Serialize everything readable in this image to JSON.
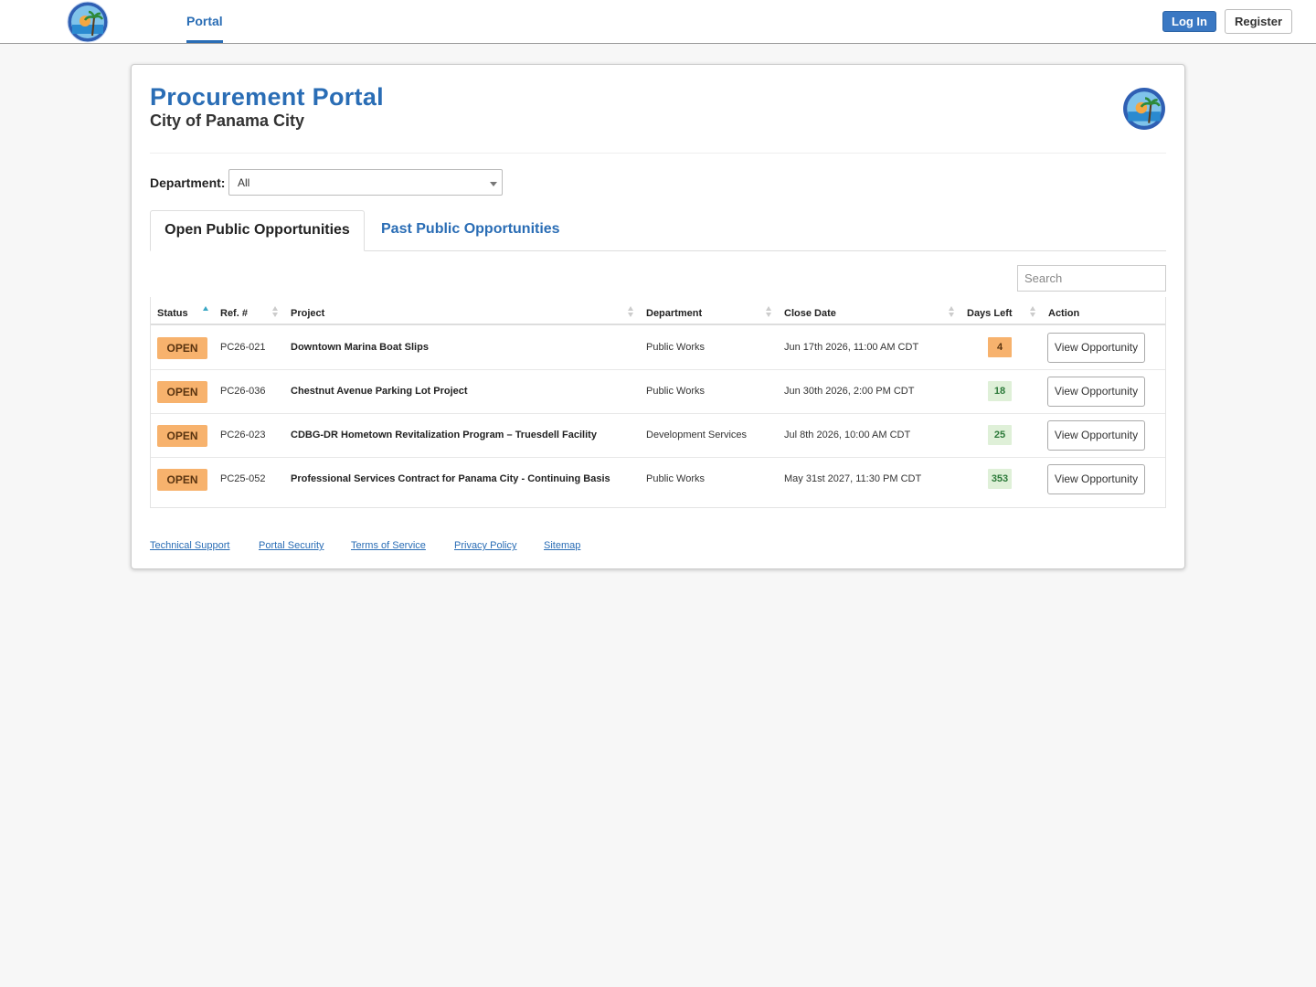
{
  "nav": {
    "portal_label": "Portal",
    "login_label": "Log In",
    "register_label": "Register"
  },
  "header": {
    "title": "Procurement Portal",
    "subtitle": "City of Panama City"
  },
  "filter": {
    "department_label": "Department:",
    "department_value": "All"
  },
  "tabs": [
    {
      "label": "Open Public Opportunities",
      "active": true
    },
    {
      "label": "Past Public Opportunities",
      "active": false
    }
  ],
  "search": {
    "placeholder": "Search"
  },
  "table": {
    "columns": [
      "Status",
      "Ref. #",
      "Project",
      "Department",
      "Close Date",
      "Days Left",
      "Action"
    ],
    "rows": [
      {
        "status": "OPEN",
        "ref": "PC26-021",
        "project": "Downtown Marina Boat Slips",
        "department": "Public Works",
        "close_date": "Jun 17th 2026, 11:00 AM CDT",
        "days_left": "4",
        "action": "View Opportunity"
      },
      {
        "status": "OPEN",
        "ref": "PC26-036",
        "project": "Chestnut Avenue Parking Lot Project",
        "department": "Public Works",
        "close_date": "Jun 30th 2026, 2:00 PM CDT",
        "days_left": "18",
        "action": "View Opportunity"
      },
      {
        "status": "OPEN",
        "ref": "PC26-023",
        "project": "CDBG-DR Hometown Revitalization Program – Truesdell Facility",
        "department": "Development Services",
        "close_date": "Jul 8th 2026, 10:00 AM CDT",
        "days_left": "25",
        "action": "View Opportunity"
      },
      {
        "status": "OPEN",
        "ref": "PC25-052",
        "project": "Professional Services Contract for Panama City - Continuing Basis",
        "department": "Public Works",
        "close_date": "May 31st 2027, 11:30 PM CDT",
        "days_left": "353",
        "action": "View Opportunity"
      }
    ]
  },
  "footer": {
    "links": [
      "Technical Support",
      "Portal Security",
      "Terms of Service",
      "Privacy Policy",
      "Sitemap"
    ]
  },
  "colors": {
    "brand_blue": "#2a6db5",
    "open_badge": "#f7b26d",
    "days_green_bg": "#dff0d8",
    "days_green_text": "#2d7a3a"
  }
}
